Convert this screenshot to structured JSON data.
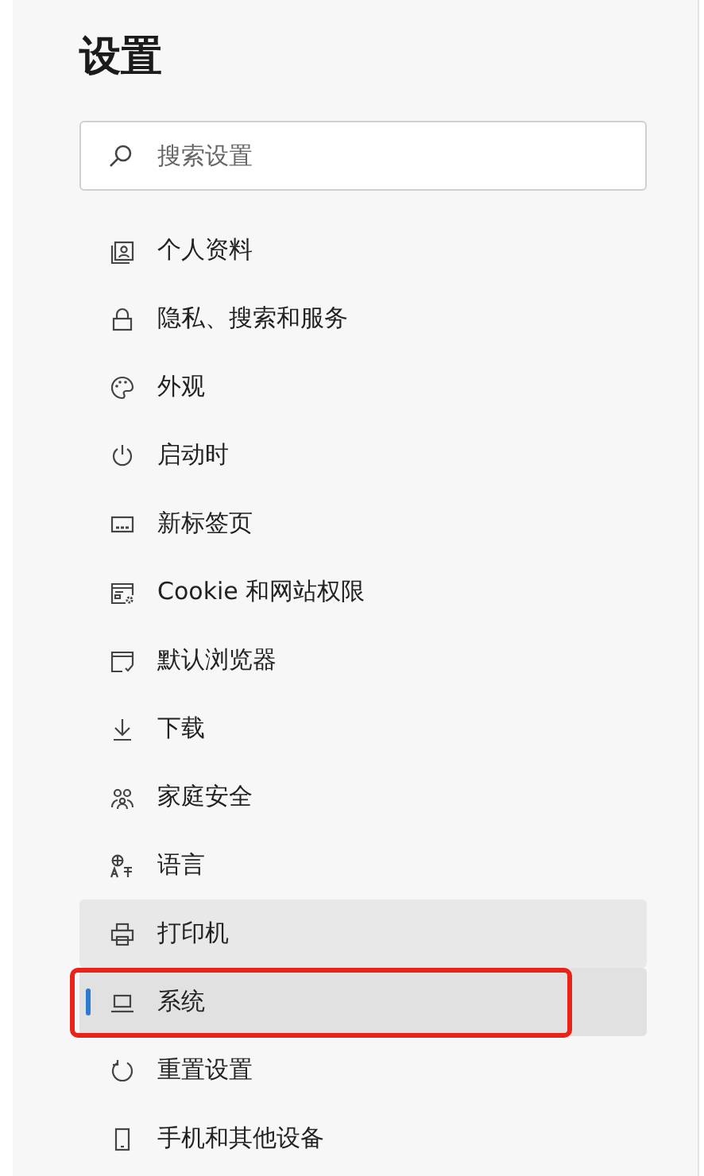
{
  "title": "设置",
  "search": {
    "placeholder": "搜索设置"
  },
  "nav_items": [
    {
      "label": "个人资料",
      "kind": "profile",
      "selected": false,
      "hovered": false,
      "annotated": false
    },
    {
      "label": "隐私、搜索和服务",
      "kind": "lock",
      "selected": false,
      "hovered": false,
      "annotated": false
    },
    {
      "label": "外观",
      "kind": "palette",
      "selected": false,
      "hovered": false,
      "annotated": false
    },
    {
      "label": "启动时",
      "kind": "power",
      "selected": false,
      "hovered": false,
      "annotated": false
    },
    {
      "label": "新标签页",
      "kind": "newtab",
      "selected": false,
      "hovered": false,
      "annotated": false
    },
    {
      "label": "Cookie 和网站权限",
      "kind": "cookie",
      "selected": false,
      "hovered": false,
      "annotated": false
    },
    {
      "label": "默认浏览器",
      "kind": "browser",
      "selected": false,
      "hovered": false,
      "annotated": false
    },
    {
      "label": "下载",
      "kind": "download",
      "selected": false,
      "hovered": false,
      "annotated": false
    },
    {
      "label": "家庭安全",
      "kind": "family",
      "selected": false,
      "hovered": false,
      "annotated": false
    },
    {
      "label": "语言",
      "kind": "language",
      "selected": false,
      "hovered": false,
      "annotated": false
    },
    {
      "label": "打印机",
      "kind": "printer",
      "selected": false,
      "hovered": true,
      "annotated": false
    },
    {
      "label": "系统",
      "kind": "laptop",
      "selected": true,
      "hovered": false,
      "annotated": true
    },
    {
      "label": "重置设置",
      "kind": "reset",
      "selected": false,
      "hovered": false,
      "annotated": false
    },
    {
      "label": "手机和其他设备",
      "kind": "phone",
      "selected": false,
      "hovered": false,
      "annotated": false
    }
  ]
}
